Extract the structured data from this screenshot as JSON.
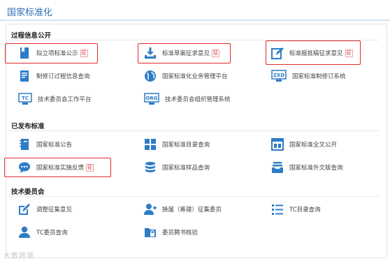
{
  "header": {
    "title": "国家标准化"
  },
  "sections": {
    "s1": "过程信息公开",
    "s2": "已发布标准",
    "s3": "技术委员会"
  },
  "items": {
    "lixiang": "拟立项标准公示",
    "caoan": "标准草案征求意见",
    "baopi": "标准报批稿征求意见",
    "zhixiuding": "制修订过程信息查询",
    "yewu": "国家标准化业务管理平台",
    "zxd": "国家标准制修订系统",
    "jswy": "技术委员会工作平台",
    "zuzhi": "技术委员会组织管理系统",
    "gonggao": "国家标准公告",
    "mulu": "国家标准目录查询",
    "quanwen": "国家标准全文公开",
    "fankui": "国家标准实施反馈",
    "yangpin": "国家标准样品查询",
    "waiwen": "国家标准外文版查询",
    "tiaozheng": "调整征集意见",
    "huanjie": "换届（筹建）征集委员",
    "tcmulu": "TC目录查询",
    "tcweiyuan": "TC委员查询",
    "pinshu": "委员聘书核验"
  },
  "badge": "征",
  "icon_text": {
    "zxd": "ZXD",
    "tc": "TC",
    "org": "ORG"
  },
  "watermark": "大数跨境",
  "colors": {
    "accent": "#2e6fb6",
    "highlight": "#e02a2a",
    "icon": "#2f7cc6"
  }
}
